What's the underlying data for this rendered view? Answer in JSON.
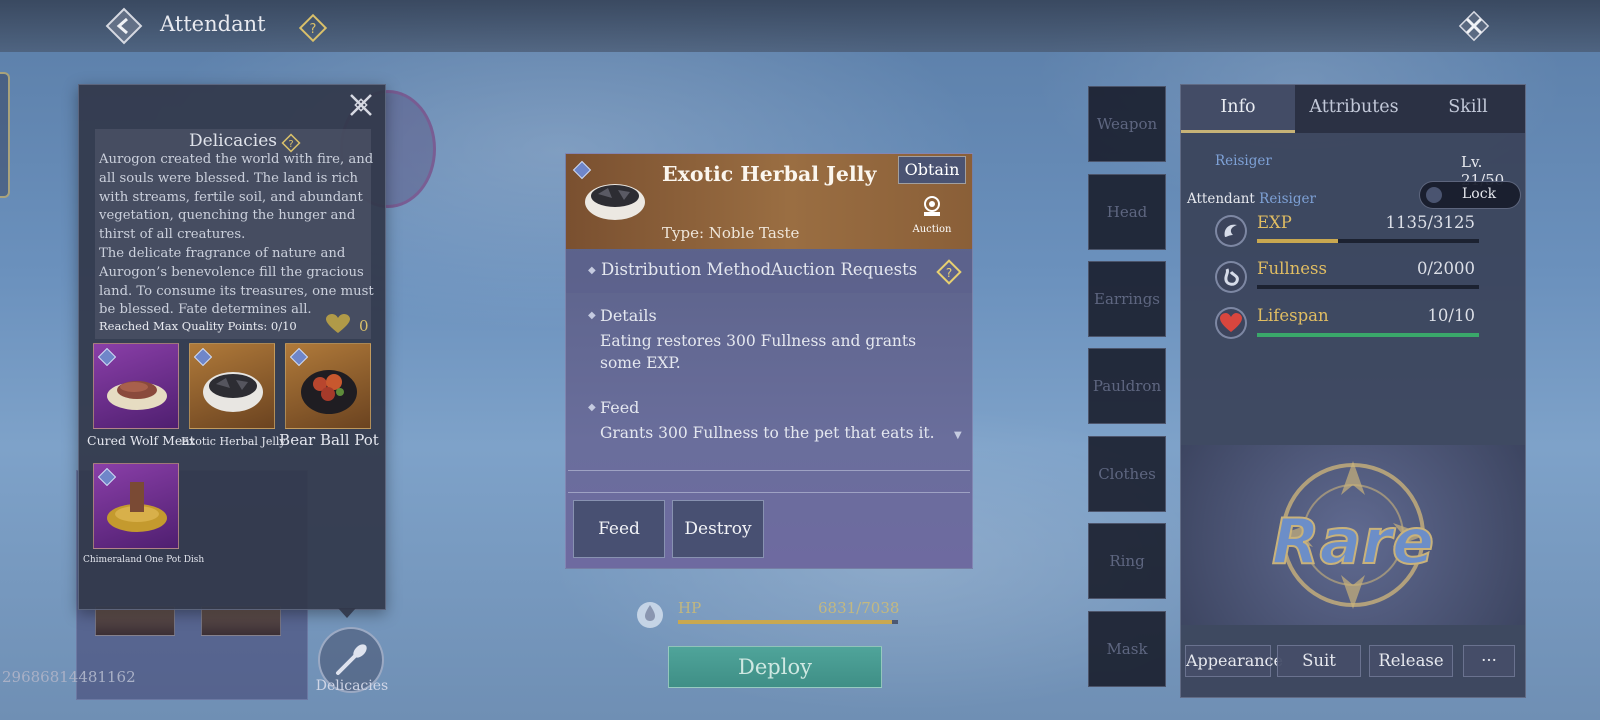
{
  "header": {
    "title": "Attendant"
  },
  "uid": "29686814481162",
  "delicacies_button": {
    "label": "Delicacies"
  },
  "popup": {
    "title": "Delicacies",
    "lore": "Aurogon created the world with fire, and all souls were blessed. The land is rich with streams, fertile soil, and abundant vegetation, quenching the hunger and thirst of all creatures.\nThe delicate fragrance of nature and Aurogon’s benevolence fill the gracious land. To consume its treasures, one must be  blessed. Fate determines all.",
    "quality_text": "Reached Max Quality Points: 0/10",
    "heart_count": "0",
    "items": [
      {
        "name": "Cured Wolf Meat",
        "rarity": "purple",
        "icon": "wolf-meat-plate-icon"
      },
      {
        "name": "Exotic Herbal Jelly",
        "rarity": "orange",
        "icon": "herbal-jelly-bowl-icon"
      },
      {
        "name": "Bear Ball Pot",
        "rarity": "orange",
        "icon": "bear-ball-pot-icon"
      },
      {
        "name": "Chimeraland One Pot Dish",
        "rarity": "purple",
        "icon": "one-pot-dish-icon"
      }
    ]
  },
  "detail": {
    "name": "Exotic Herbal Jelly",
    "type": "Type: Noble Taste",
    "obtain_label": "Obtain",
    "auction_label": "Auction",
    "distribution_label": "Distribution Method",
    "distribution_value": "Auction Requests",
    "details_title": "Details",
    "details_text": "Eating restores 300 Fullness and grants some EXP.",
    "feed_title": "Feed",
    "feed_text": "Grants 300 Fullness to the pet that eats it.",
    "feed_button": "Feed",
    "destroy_button": "Destroy"
  },
  "hp": {
    "label": "HP",
    "value": "6831/7038",
    "fraction": 0.9706
  },
  "deploy_label": "Deploy",
  "equipment": [
    "Weapon",
    "Head",
    "Earrings",
    "Pauldron",
    "Clothes",
    "Ring",
    "Mask"
  ],
  "info_panel": {
    "tabs": [
      "Info",
      "Attributes",
      "Skill"
    ],
    "active_tab": "Info",
    "class_name": "Reisiger",
    "level": "Lv. 21/50",
    "attendant_label": "Attendant",
    "attendant_class": "Reisiger",
    "lock_label": "Lock",
    "stats": [
      {
        "name": "EXP",
        "value": "1135/3125",
        "fraction": 0.363,
        "color": "#c9a850",
        "icon": "exp-swirl-icon"
      },
      {
        "name": "Fullness",
        "value": "0/2000",
        "fraction": 0,
        "color": "#c9a850",
        "icon": "stomach-icon"
      },
      {
        "name": "Lifespan",
        "value": "10/10",
        "fraction": 1.0,
        "color": "#3aa86a",
        "icon": "heart-icon"
      }
    ],
    "rarity": "Rare",
    "buttons": [
      "Appearance",
      "Suit",
      "Release",
      "···"
    ]
  },
  "colors": {
    "accent_gold": "#c7b377",
    "rare_blue": "#6c8ec8",
    "deploy_green": "#4fa49a"
  }
}
